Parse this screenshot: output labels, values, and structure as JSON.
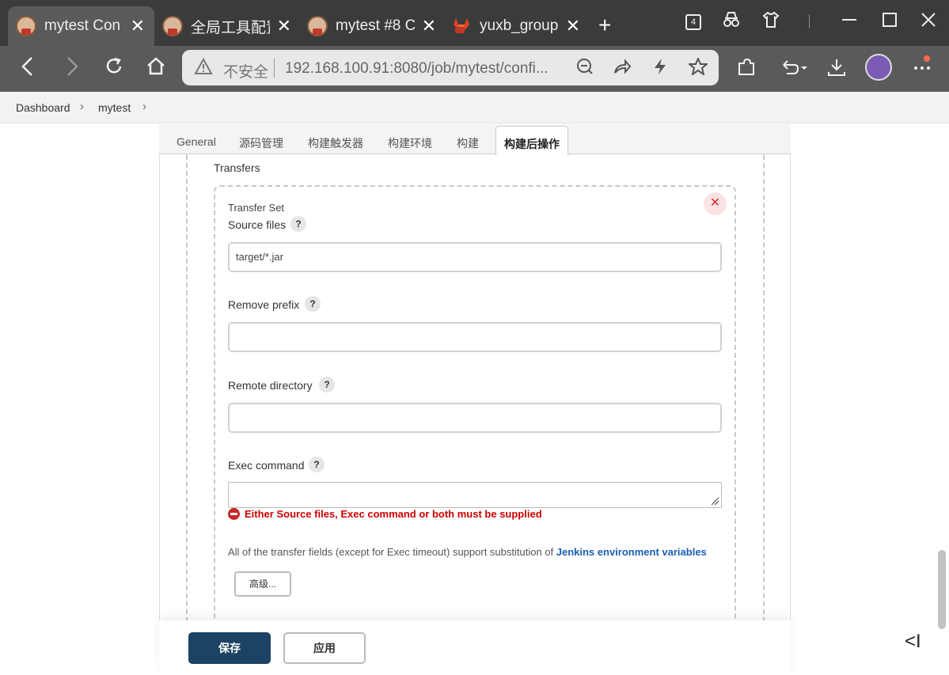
{
  "browser": {
    "tabs": [
      {
        "title": "mytest Con",
        "icon": "jenkins-icon",
        "active": true
      },
      {
        "title": "全局工具配置",
        "icon": "jenkins-icon",
        "active": false
      },
      {
        "title": "mytest #8 C",
        "icon": "jenkins-icon",
        "active": false
      },
      {
        "title": "yuxb_group",
        "icon": "gitlab-icon",
        "active": false
      }
    ],
    "tab_close": "✕",
    "new_tab": "+",
    "tab_count": "4",
    "insecure_label": "不安全",
    "url": "192.168.100.91:8080/job/mytest/confi..."
  },
  "breadcrumb": {
    "items": [
      "Dashboard",
      "mytest"
    ],
    "separator": "›"
  },
  "config_tabs": [
    "General",
    "源码管理",
    "构建触发器",
    "构建环境",
    "构建",
    "构建后操作"
  ],
  "active_tab": "构建后操作",
  "transfers": {
    "heading": "Transfers",
    "set_title": "Transfer Set",
    "remove_symbol": "✕",
    "help_symbol": "?",
    "fields": {
      "source_files": {
        "label": "Source files",
        "value": "target/*.jar"
      },
      "remove_prefix": {
        "label": "Remove prefix",
        "value": ""
      },
      "remote_directory": {
        "label": "Remote directory",
        "value": ""
      },
      "exec_command": {
        "label": "Exec command",
        "value": ""
      }
    },
    "error": "Either Source files, Exec command or both must be supplied",
    "note_prefix": "All of the transfer fields (except for Exec timeout) support substitution of ",
    "note_link": "Jenkins environment variables",
    "advanced_button": "高级..."
  },
  "footer": {
    "save": "保存",
    "apply": "应用"
  },
  "side_collapse": "<I",
  "colors": {
    "save_button": "#1c4363",
    "error": "#cc0000",
    "link": "#1a5fb4"
  }
}
